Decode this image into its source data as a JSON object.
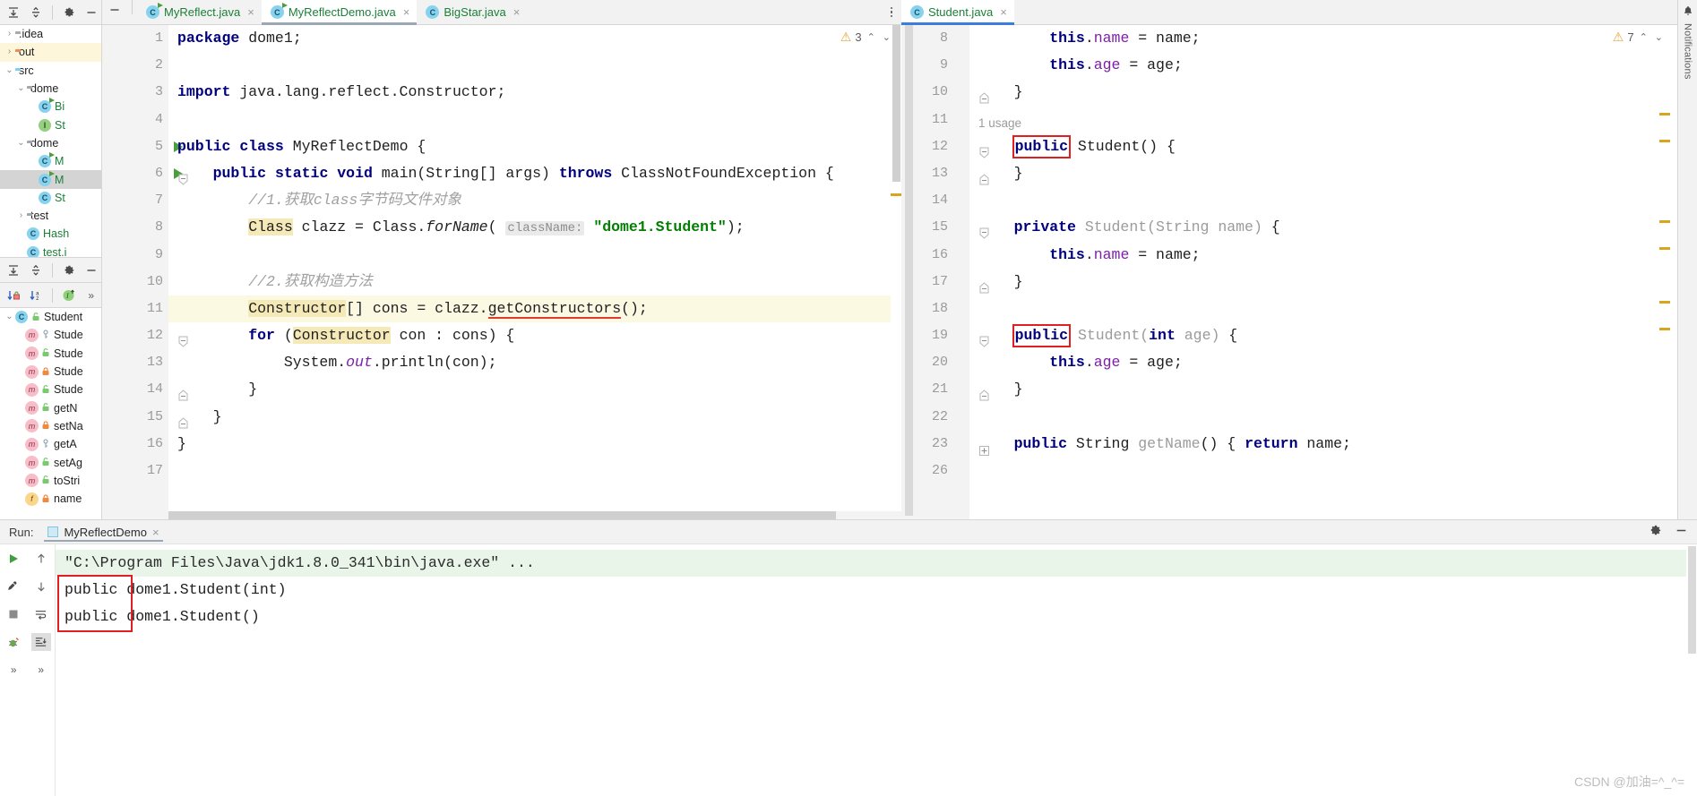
{
  "toolbars": {
    "project_tool_icons": [
      "expand-all-icon",
      "collapse-all-icon",
      "settings-icon",
      "hide-icon"
    ],
    "structure_tool_icons": [
      "expand-all-icon",
      "collapse-all-icon",
      "settings-icon",
      "hide-icon"
    ],
    "structure_sort_icons": [
      "sort-by-visibility-icon",
      "sort-alphabetically-icon",
      "show-inherited-icon",
      "more-icon"
    ]
  },
  "project_tree": [
    {
      "arrow": "›",
      "icon": "folder-gray",
      "label": ".idea",
      "indent": 1,
      "state": ""
    },
    {
      "arrow": "›",
      "icon": "folder-orange",
      "label": "out",
      "indent": 1,
      "state": "hl"
    },
    {
      "arrow": "⌄",
      "icon": "folder-blue",
      "label": "src",
      "indent": 1,
      "state": ""
    },
    {
      "arrow": "⌄",
      "icon": "folder-pkg",
      "label": "dome",
      "indent": 2,
      "state": ""
    },
    {
      "arrow": "",
      "icon": "class-run",
      "label": "Bi",
      "indent": 3,
      "state": ""
    },
    {
      "arrow": "",
      "icon": "interface",
      "label": "St",
      "indent": 3,
      "state": ""
    },
    {
      "arrow": "⌄",
      "icon": "folder-pkg",
      "label": "dome",
      "indent": 2,
      "state": ""
    },
    {
      "arrow": "",
      "icon": "class-run",
      "label": "M",
      "indent": 3,
      "state": ""
    },
    {
      "arrow": "",
      "icon": "class-run",
      "label": "M",
      "indent": 3,
      "state": "sel"
    },
    {
      "arrow": "",
      "icon": "class",
      "label": "St",
      "indent": 3,
      "state": ""
    },
    {
      "arrow": "›",
      "icon": "folder-pkg",
      "label": "test",
      "indent": 2,
      "state": ""
    },
    {
      "arrow": "",
      "icon": "class",
      "label": "Hash",
      "indent": 2,
      "state": ""
    },
    {
      "arrow": "",
      "icon": "class",
      "label": "test.i",
      "indent": 2,
      "state": ""
    }
  ],
  "structure_tree": [
    {
      "kind": "class",
      "lock": "public",
      "label": "Student",
      "indent": 0,
      "arrow": "⌄"
    },
    {
      "kind": "method",
      "lock": "private-key",
      "label": "Stude",
      "indent": 1,
      "arrow": ""
    },
    {
      "kind": "method",
      "lock": "public",
      "label": "Stude",
      "indent": 1,
      "arrow": ""
    },
    {
      "kind": "method",
      "lock": "protected",
      "label": "Stude",
      "indent": 1,
      "arrow": ""
    },
    {
      "kind": "method",
      "lock": "public",
      "label": "Stude",
      "indent": 1,
      "arrow": ""
    },
    {
      "kind": "method",
      "lock": "public",
      "label": "getN",
      "indent": 1,
      "arrow": ""
    },
    {
      "kind": "method",
      "lock": "protected",
      "label": "setNa",
      "indent": 1,
      "arrow": ""
    },
    {
      "kind": "method",
      "lock": "private-key",
      "label": "getA",
      "indent": 1,
      "arrow": ""
    },
    {
      "kind": "method",
      "lock": "public",
      "label": "setAg",
      "indent": 1,
      "arrow": ""
    },
    {
      "kind": "method",
      "lock": "public",
      "label": "toStri",
      "indent": 1,
      "arrow": ""
    },
    {
      "kind": "field",
      "lock": "protected",
      "label": "name",
      "indent": 1,
      "arrow": ""
    }
  ],
  "left_editor": {
    "tabs": [
      {
        "label": "MyReflect.java",
        "icon": "java-class-runnable-icon",
        "active": false,
        "close": "×"
      },
      {
        "label": "MyReflectDemo.java",
        "icon": "java-class-runnable-icon",
        "active": true,
        "close": "×"
      },
      {
        "label": "BigStar.java",
        "icon": "java-class-icon",
        "active": false,
        "close": "×"
      }
    ],
    "inspection": {
      "warning_count": "3",
      "warn_icon": "warning-triangle-icon",
      "up": "⌃",
      "down": "⌄"
    },
    "lines": [
      {
        "no": "1",
        "caret": false,
        "gutter_run": false,
        "fold": ""
      },
      {
        "no": "2",
        "caret": false,
        "gutter_run": false,
        "fold": ""
      },
      {
        "no": "3",
        "caret": false,
        "gutter_run": false,
        "fold": ""
      },
      {
        "no": "4",
        "caret": false,
        "gutter_run": false,
        "fold": ""
      },
      {
        "no": "5",
        "caret": false,
        "gutter_run": true,
        "fold": ""
      },
      {
        "no": "6",
        "caret": false,
        "gutter_run": true,
        "fold": "minus"
      },
      {
        "no": "7",
        "caret": false,
        "gutter_run": false,
        "fold": ""
      },
      {
        "no": "8",
        "caret": false,
        "gutter_run": false,
        "fold": ""
      },
      {
        "no": "9",
        "caret": false,
        "gutter_run": false,
        "fold": ""
      },
      {
        "no": "10",
        "caret": false,
        "gutter_run": false,
        "fold": ""
      },
      {
        "no": "11",
        "caret": true,
        "gutter_run": false,
        "fold": ""
      },
      {
        "no": "12",
        "caret": false,
        "gutter_run": false,
        "fold": "minus"
      },
      {
        "no": "13",
        "caret": false,
        "gutter_run": false,
        "fold": ""
      },
      {
        "no": "14",
        "caret": false,
        "gutter_run": false,
        "fold": "end"
      },
      {
        "no": "15",
        "caret": false,
        "gutter_run": false,
        "fold": "end"
      },
      {
        "no": "16",
        "caret": false,
        "gutter_run": false,
        "fold": ""
      },
      {
        "no": "17",
        "caret": false,
        "gutter_run": false,
        "fold": ""
      }
    ],
    "code_text": [
      "package dome1;",
      "",
      "import java.lang.reflect.Constructor;",
      "",
      "public class MyReflectDemo {",
      "    public static void main(String[] args) throws ClassNotFoundException {",
      "        //1.获取class字节码文件对象",
      "        Class clazz = Class.forName( className: \"dome1.Student\");",
      "",
      "        //2.获取构造方法",
      "        Constructor[] cons = clazz.getConstructors();",
      "        for (Constructor con : cons) {",
      "            System.out.println(con);",
      "        }",
      "    }",
      "}",
      ""
    ]
  },
  "right_editor": {
    "tabs": [
      {
        "label": "Student.java",
        "icon": "java-class-icon",
        "active": true,
        "close": "×"
      }
    ],
    "inspection": {
      "warning_count": "7",
      "warn_icon": "warning-triangle-icon",
      "up": "⌃",
      "down": "⌄"
    },
    "lines": [
      {
        "no": "8",
        "fold": ""
      },
      {
        "no": "9",
        "fold": ""
      },
      {
        "no": "10",
        "fold": "end"
      },
      {
        "no": "11",
        "fold": ""
      },
      {
        "no": "12",
        "fold": "minus"
      },
      {
        "no": "13",
        "fold": "end"
      },
      {
        "no": "14",
        "fold": ""
      },
      {
        "no": "15",
        "fold": "minus"
      },
      {
        "no": "16",
        "fold": ""
      },
      {
        "no": "17",
        "fold": "end"
      },
      {
        "no": "18",
        "fold": ""
      },
      {
        "no": "19",
        "fold": "minus"
      },
      {
        "no": "20",
        "fold": ""
      },
      {
        "no": "21",
        "fold": "end"
      },
      {
        "no": "22",
        "fold": ""
      },
      {
        "no": "23",
        "fold": "plus"
      },
      {
        "no": "26",
        "fold": ""
      }
    ],
    "usage_hint": "1 usage",
    "code_text": [
      "        this.name = name;",
      "        this.age = age;",
      "    }",
      "",
      "    public Student() {",
      "    }",
      "",
      "    private Student(String name) {",
      "        this.name = name;",
      "    }",
      "",
      "    public Student(int age) {",
      "        this.age = age;",
      "    }",
      "",
      "    public String getName() { return name;",
      ""
    ]
  },
  "run_panel": {
    "label": "Run:",
    "tab_label": "MyReflectDemo",
    "tab_close": "×",
    "tab_icon": "run-config-icon",
    "tools": [
      "settings-icon",
      "hide-icon"
    ],
    "side_icons_left": [
      "rerun-icon",
      "edit-config-icon",
      "stop-icon",
      "debug-icon",
      "expand-more-icon"
    ],
    "side_icons_right": [
      "up-arrow-icon",
      "down-arrow-icon",
      "soft-wrap-icon",
      "scroll-to-end-icon",
      "expand-more-icon"
    ],
    "console_lines": [
      {
        "text": "\"C:\\Program Files\\Java\\jdk1.8.0_341\\bin\\java.exe\" ...",
        "type": "command"
      },
      {
        "text": "public dome1.Student(int)",
        "type": "out"
      },
      {
        "text": "public dome1.Student()",
        "type": "out"
      }
    ]
  },
  "notifications": {
    "label": "Notifications",
    "icon": "bell-icon"
  },
  "watermark": "CSDN @加油=^_^=",
  "colors": {
    "accent_blue": "#3b7ddd",
    "tab_green": "#1a7f37",
    "keyword": "#00007f",
    "string": "#007f00",
    "comment": "#a0a0a0",
    "highlight_box_red": "#e02020",
    "caret_line": "#fcf9e3"
  }
}
